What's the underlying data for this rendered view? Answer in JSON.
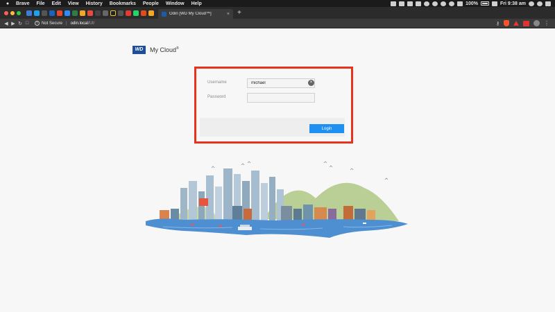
{
  "menubar": {
    "items": [
      "Brave",
      "File",
      "Edit",
      "View",
      "History",
      "Bookmarks",
      "People",
      "Window",
      "Help"
    ],
    "battery_percent": "100%",
    "clock": "Fri 9:38 am"
  },
  "tab": {
    "title": "Odin [WD My Cloud™]"
  },
  "addressbar": {
    "security": "Not Secure",
    "host": "odin.local",
    "path": "/UI/"
  },
  "brand": {
    "logo_text": "WD",
    "product": "My Cloud"
  },
  "login": {
    "username_label": "Username",
    "username_value": "michael",
    "password_label": "Password",
    "password_value": "",
    "submit_label": "Login"
  },
  "colors": {
    "highlight": "#e8321b",
    "button": "#1e90f2",
    "brand": "#1d4e97"
  }
}
